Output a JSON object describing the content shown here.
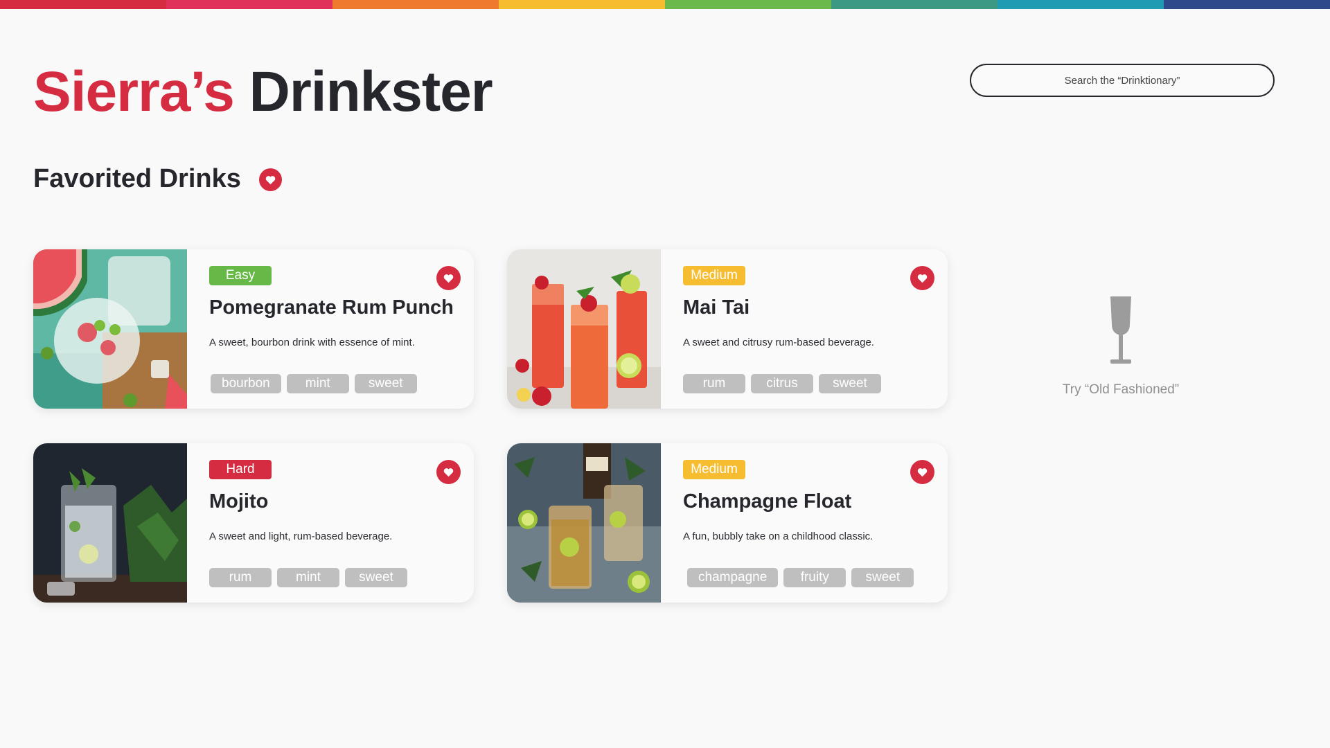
{
  "header": {
    "brand_first": "Sierra’s",
    "brand_second": "Drinkster",
    "rainbow_colors": [
      "#d52c41",
      "#e0315b",
      "#ef7a2f",
      "#f6bd31",
      "#6ab94a",
      "#3c9a83",
      "#1f9bb3",
      "#2f4a8a"
    ]
  },
  "search": {
    "placeholder": "Search the “Drinktionary”"
  },
  "section": {
    "title": "Favorited Drinks"
  },
  "cards": [
    {
      "difficulty": "Easy",
      "difficulty_color": "#66b946",
      "name": "Pomegranate Rum Punch",
      "description": "A sweet, bourbon drink with essence of mint.",
      "tags": [
        "bourbon",
        "mint",
        "sweet"
      ],
      "image": "watermelon-cocktail-photo"
    },
    {
      "difficulty": "Medium",
      "difficulty_color": "#f6bd31",
      "name": "Mai Tai",
      "description": "A sweet and citrusy rum-based beverage.",
      "tags": [
        "rum",
        "citrus",
        "sweet"
      ],
      "image": "red-cocktails-photo"
    },
    {
      "difficulty": "Hard",
      "difficulty_color": "#d52c41",
      "name": "Mojito",
      "description": "A sweet and light, rum-based beverage.",
      "tags": [
        "rum",
        "mint",
        "sweet"
      ],
      "image": "mojito-glass-photo"
    },
    {
      "difficulty": "Medium",
      "difficulty_color": "#f6bd31",
      "name": "Champagne Float",
      "description": "A fun, bubbly take on a childhood classic.",
      "tags": [
        "champagne",
        "fruity",
        "sweet"
      ],
      "image": "lime-cocktails-photo"
    }
  ],
  "suggestion": {
    "icon": "wine-glass-icon",
    "text": "Try “Old Fashioned”"
  },
  "colors": {
    "accent": "#d52c41",
    "dark": "#25272d",
    "tag_bg": "#bfbfbf",
    "muted": "#8f8f8f"
  }
}
